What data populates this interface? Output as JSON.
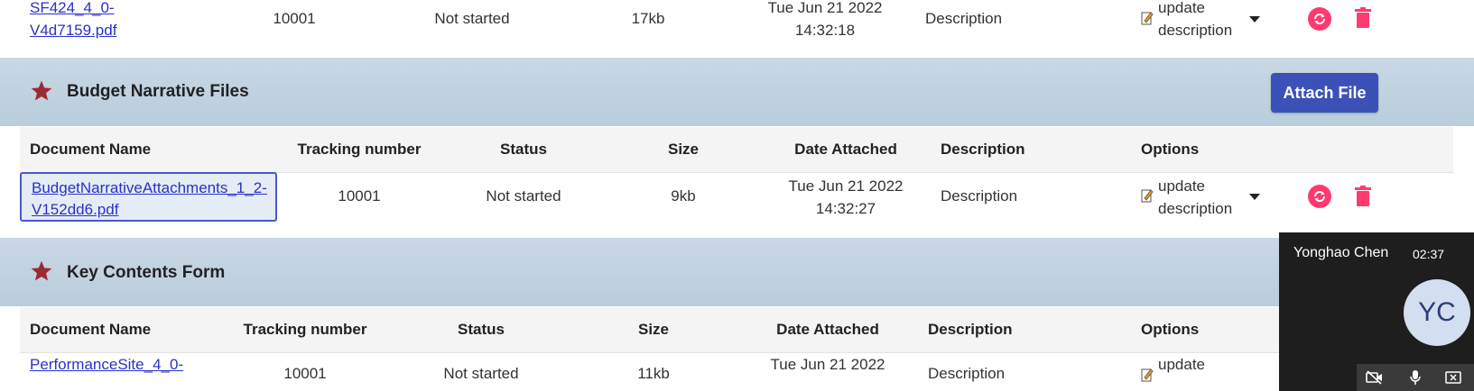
{
  "sections": {
    "sf424": {
      "rows": [
        {
          "document_name_line1": "SF424_4_0-",
          "document_name_line2": "V4d7159.pdf",
          "tracking_number": "10001",
          "status": "Not started",
          "size": "17kb",
          "date_line1": "Tue Jun 21 2022",
          "date_line2": "14:32:18",
          "description": "Description",
          "option_line1": "update",
          "option_line2": "description"
        }
      ]
    },
    "budget_narrative": {
      "title": "Budget Narrative Files",
      "attach_label": "Attach File",
      "headers": [
        "Document Name",
        "Tracking number",
        "Status",
        "Size",
        "Date Attached",
        "Description",
        "Options"
      ],
      "rows": [
        {
          "document_name_line1": "BudgetNarrativeAttachments_1_2-",
          "document_name_line2": "V152dd6.pdf",
          "tracking_number": "10001",
          "status": "Not started",
          "size": "9kb",
          "date_line1": "Tue Jun 21 2022",
          "date_line2": "14:32:27",
          "description": "Description",
          "option_line1": "update",
          "option_line2": "description"
        }
      ]
    },
    "key_contents": {
      "title": "Key Contents Form",
      "headers": [
        "Document Name",
        "Tracking number",
        "Status",
        "Size",
        "Date Attached",
        "Description",
        "Options"
      ],
      "rows": [
        {
          "document_name_line1": "PerformanceSite_4_0-",
          "tracking_number": "10001",
          "status": "Not started",
          "size": "11kb",
          "date_line1": "Tue Jun 21 2022",
          "description": "Description",
          "option_line1": "update"
        }
      ]
    }
  },
  "video_call": {
    "participant_name": "Yonghao Chen",
    "elapsed": "02:37",
    "initials": "YC"
  },
  "colors": {
    "accent_blue": "#3c51b8",
    "action_pink": "#ff3a6e",
    "star_red": "#9b2b34",
    "band_blue": "#c3d4e1"
  },
  "icons": [
    "pencil-icon",
    "chevron-down-icon",
    "refresh-icon",
    "trash-icon",
    "star-icon",
    "camera-off-icon",
    "microphone-icon",
    "close-box-icon"
  ]
}
